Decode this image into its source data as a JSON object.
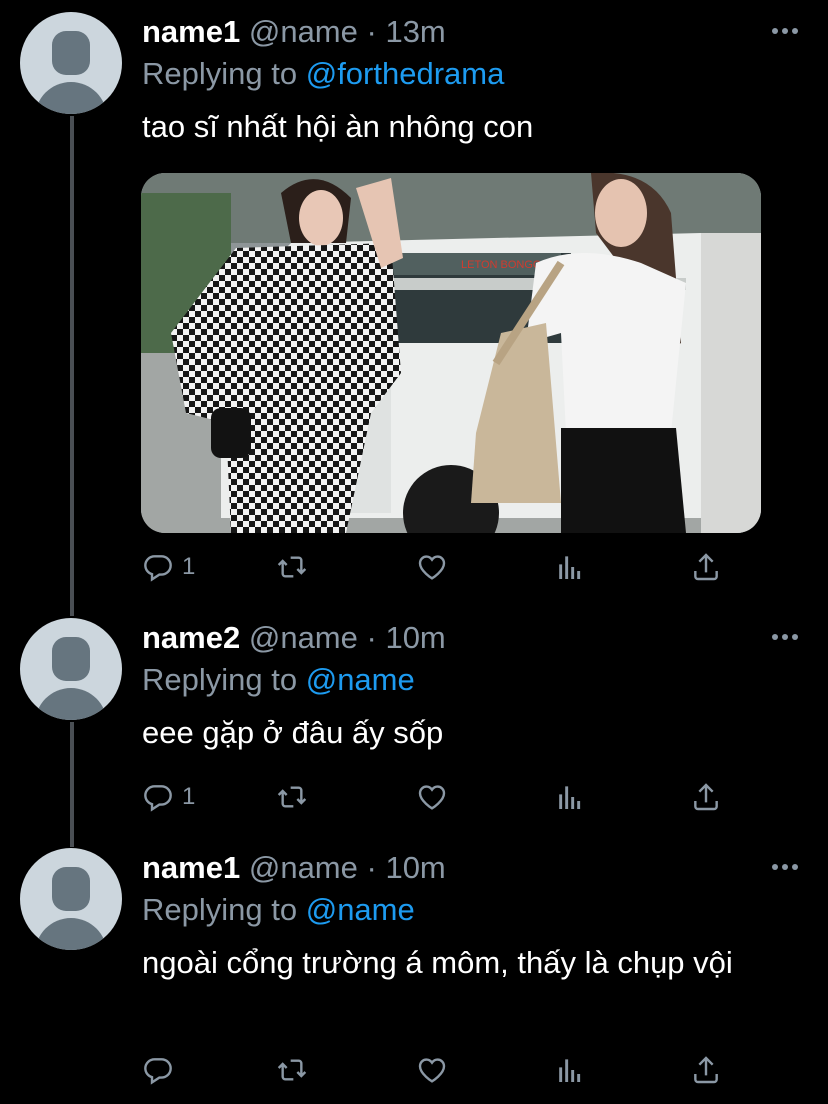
{
  "tweets": [
    {
      "name": "name1",
      "handle": "@name",
      "separator": "·",
      "time": "13m",
      "replying_prefix": "Replying to",
      "replying_to": "@forthedrama",
      "text": "tao sĩ nhất hội àn nhông con",
      "reply_count": "1",
      "photo_sign": "LETON BONGO"
    },
    {
      "name": "name2",
      "handle": "@name",
      "separator": "·",
      "time": "10m",
      "replying_prefix": "Replying to",
      "replying_to": "@name",
      "text": "eee gặp ở đâu ấy sốp",
      "reply_count": "1"
    },
    {
      "name": "name1",
      "handle": "@name",
      "separator": "·",
      "time": "10m",
      "replying_prefix": "Replying to",
      "replying_to": "@name",
      "text": "ngoài cổng trường á môm, thấy là chụp vội",
      "reply_count": ""
    }
  ],
  "icons": [
    "reply-icon",
    "retweet-icon",
    "like-icon",
    "analytics-icon",
    "share-icon",
    "more-icon"
  ],
  "colors": {
    "background": "#000000",
    "secondary_text": "#8b98a5",
    "link": "#1d9bf0",
    "avatar_bg": "#ccd6dd",
    "avatar_fg": "#66757f"
  }
}
